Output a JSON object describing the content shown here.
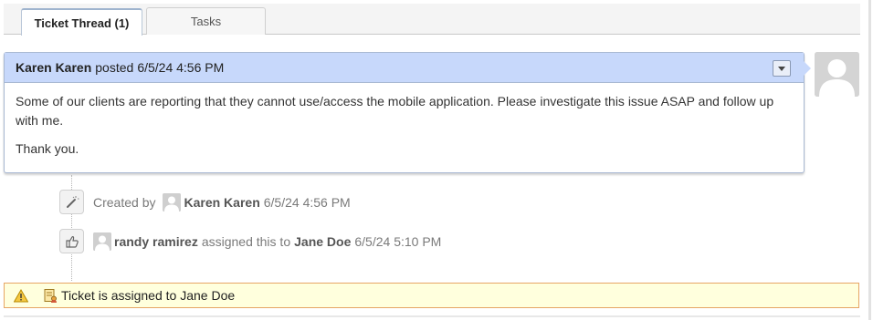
{
  "tabs": [
    {
      "label": "Ticket Thread (1)",
      "active": true
    },
    {
      "label": "Tasks",
      "active": false
    }
  ],
  "thread": {
    "author": "Karen Karen",
    "action": "posted",
    "timestamp": "6/5/24 4:56 PM",
    "body_lines": [
      "Some of our clients are reporting that they cannot use/access the mobile application. Please investigate this issue ASAP and follow up with me.",
      "Thank you."
    ],
    "header_color": "#c7d8fb"
  },
  "events": {
    "created": {
      "prefix": "Created by",
      "user": "Karen Karen",
      "timestamp": "6/5/24 4:56 PM",
      "icon": "magic-wand-icon"
    },
    "assigned": {
      "user": "randy ramirez",
      "text": "assigned this to",
      "assignee": "Jane Doe",
      "timestamp": "6/5/24 5:10 PM",
      "icon": "thumbs-pointing-hand-icon"
    }
  },
  "notice": {
    "text": "Ticket is assigned to Jane Doe",
    "background": "#ffffdd",
    "border": "#e6a565"
  }
}
